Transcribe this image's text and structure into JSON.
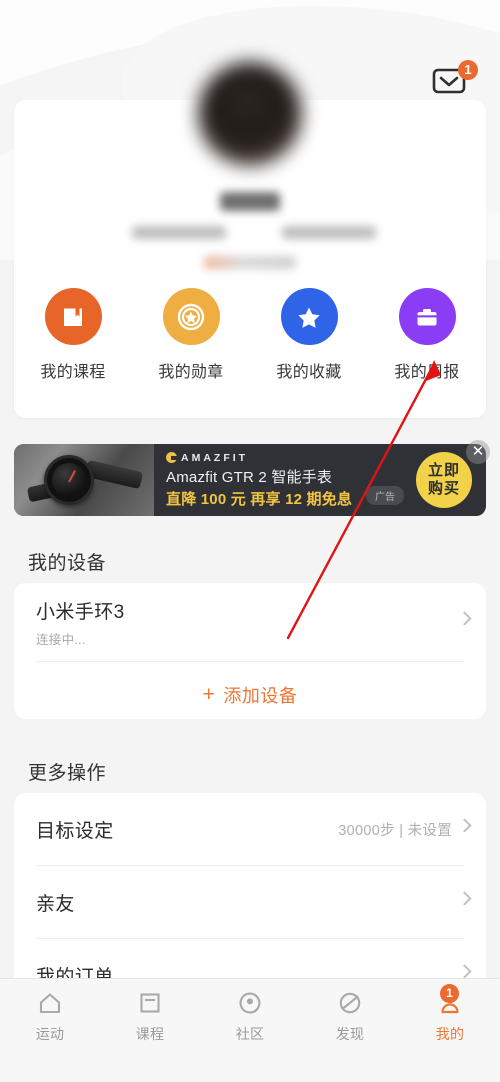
{
  "header": {
    "mail_icon": "envelope-icon",
    "mail_badge": "1"
  },
  "profile": {
    "avatar": "user-avatar-blurred",
    "name_redacted": "",
    "stat_left_redacted": "",
    "stat_right_redacted": "",
    "tag_redacted": ""
  },
  "quick_actions": [
    {
      "label": "我的课程",
      "icon": "book-icon",
      "color": "#e8652a"
    },
    {
      "label": "我的勋章",
      "icon": "medal-icon",
      "color": "#efae42"
    },
    {
      "label": "我的收藏",
      "icon": "star-icon",
      "color": "#2f63e8"
    },
    {
      "label": "我的周报",
      "icon": "briefcase-icon",
      "color": "#8b3cf5"
    }
  ],
  "ad": {
    "brand": "AMAZFIT",
    "title": "Amazfit GTR 2 智能手表",
    "subtitle": "直降 100 元 再享 12 期免息",
    "tag": "广告",
    "cta_line1": "立即",
    "cta_line2": "购买",
    "close_icon": "close-icon",
    "product_image": "smartwatch-photo",
    "bg_color": "#2f3136",
    "cta_color": "#f2d249",
    "highlight_color": "#f2c541"
  },
  "devices": {
    "section_title": "我的设备",
    "items": [
      {
        "name": "小米手环3",
        "status": "连接中..."
      }
    ],
    "add_label": "添加设备",
    "add_plus": "+",
    "add_color": "#ee7733"
  },
  "more": {
    "section_title": "更多操作",
    "items": [
      {
        "label": "目标设定",
        "value": "30000步 | 未设置"
      },
      {
        "label": "亲友",
        "value": ""
      },
      {
        "label": "我的订单",
        "value": ""
      }
    ]
  },
  "bottom_nav": {
    "items": [
      {
        "label": "运动",
        "icon": "home-icon",
        "active": false,
        "badge": ""
      },
      {
        "label": "课程",
        "icon": "course-icon",
        "active": false,
        "badge": ""
      },
      {
        "label": "社区",
        "icon": "community-icon",
        "active": false,
        "badge": ""
      },
      {
        "label": "发现",
        "icon": "discover-icon",
        "active": false,
        "badge": ""
      },
      {
        "label": "我的",
        "icon": "profile-icon",
        "active": true,
        "badge": "1"
      }
    ],
    "active_color": "#ee7733",
    "inactive_color": "#9a9a9a"
  },
  "annotation": {
    "type": "arrow",
    "color": "#e11414",
    "points_to": "我的周报"
  }
}
